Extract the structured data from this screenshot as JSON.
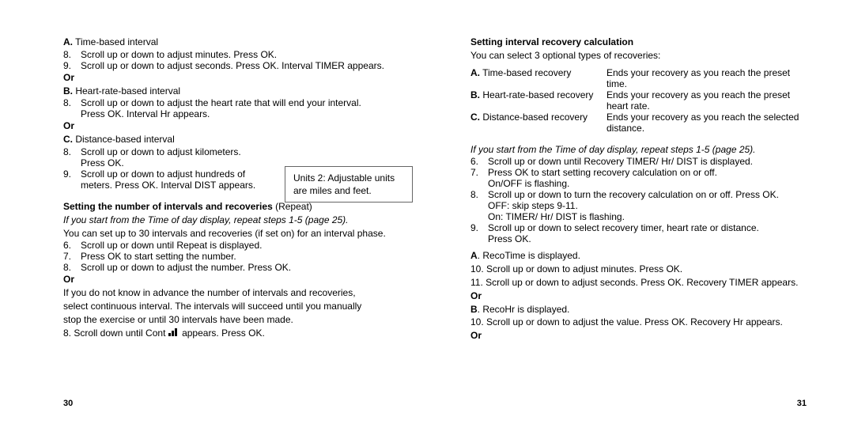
{
  "left": {
    "sectionA": {
      "heading_bold": "A.",
      "heading_text": " Time-based interval",
      "step8": "Scroll up or down to adjust minutes. Press OK.",
      "step9": "Scroll up or down to adjust seconds. Press OK. Interval TIMER appears."
    },
    "or1": "Or",
    "sectionB": {
      "heading_bold": "B.",
      "heading_text": " Heart-rate-based interval",
      "step8a": "Scroll up or down to adjust the heart rate that will end your interval.",
      "step8b": "Press OK. Interval Hr appears."
    },
    "or2": "Or",
    "sectionC": {
      "heading_bold": "C.",
      "heading_text": " Distance-based interval",
      "step8a": "Scroll up or down to adjust kilometers.",
      "step8b": "Press OK.",
      "step9a": "Scroll up or down to adjust hundreds of",
      "step9b": "meters. Press OK. Interval DIST appears."
    },
    "note": {
      "l1": "Units 2: Adjustable units",
      "l2": "are miles and feet."
    },
    "repeat": {
      "heading_bold": "Setting the number of intervals and recoveries",
      "heading_after": " (Repeat)",
      "italic": "If you start from the Time of day display, repeat steps 1-5 (page 25).",
      "intro": "You can set up to 30 intervals and recoveries (if set on) for an interval phase.",
      "step6": "Scroll up or down until Repeat is displayed.",
      "step7": "Press OK to start setting the number.",
      "step8": "Scroll up or down to adjust the number. Press OK.",
      "or": "Or",
      "cont1": "If you do not know in advance the number of intervals and recoveries,",
      "cont2": "select continuous interval. The intervals will succeed until you manually",
      "cont3": "stop the exercise or until 30 intervals have been made.",
      "step8b_pre": "8. Scroll down until Cont ",
      "step8b_post": " appears. Press OK."
    },
    "pagenum": "30"
  },
  "right": {
    "heading": "Setting interval recovery calculation",
    "intro": "You can select 3 optional types of recoveries:",
    "types": {
      "a_bold": "A.",
      "a_label": " Time-based recovery",
      "a_desc": "Ends your recovery as you reach the preset time.",
      "b_bold": "B.",
      "b_label": " Heart-rate-based recovery",
      "b_desc1": "Ends your recovery as you reach the preset",
      "b_desc2": "heart rate.",
      "c_bold": "C.",
      "c_label": " Distance-based recovery",
      "c_desc1": "Ends your recovery as you reach the selected",
      "c_desc2": "distance."
    },
    "italic": "If you start from the Time of day display, repeat steps 1-5 (page 25).",
    "step6": "Scroll up or down until Recovery TIMER/ Hr/ DIST is displayed.",
    "step7a": "Press OK to start setting recovery calculation on or off.",
    "step7b": "On/OFF is flashing.",
    "step8a": "Scroll up or down to turn the recovery calculation on or off. Press OK.",
    "step8b": "OFF: skip steps 9-11.",
    "step8c": "On: TIMER/ Hr/ DIST is flashing.",
    "step9a": "Scroll up or down to select recovery timer, heart rate or distance.",
    "step9b": "Press OK.",
    "a_bold": "A",
    "a_text": ".   RecoTime is displayed.",
    "step10a": "10.  Scroll up or down to adjust minutes. Press OK.",
    "step11a": "11.  Scroll up or down to adjust seconds. Press OK. Recovery TIMER appears.",
    "or1": "Or",
    "b_bold": "B",
    "b_text": ".   RecoHr is displayed.",
    "step10b": "10.  Scroll up or down to adjust the value. Press OK. Recovery Hr appears.",
    "or2": "Or",
    "pagenum": "31"
  }
}
